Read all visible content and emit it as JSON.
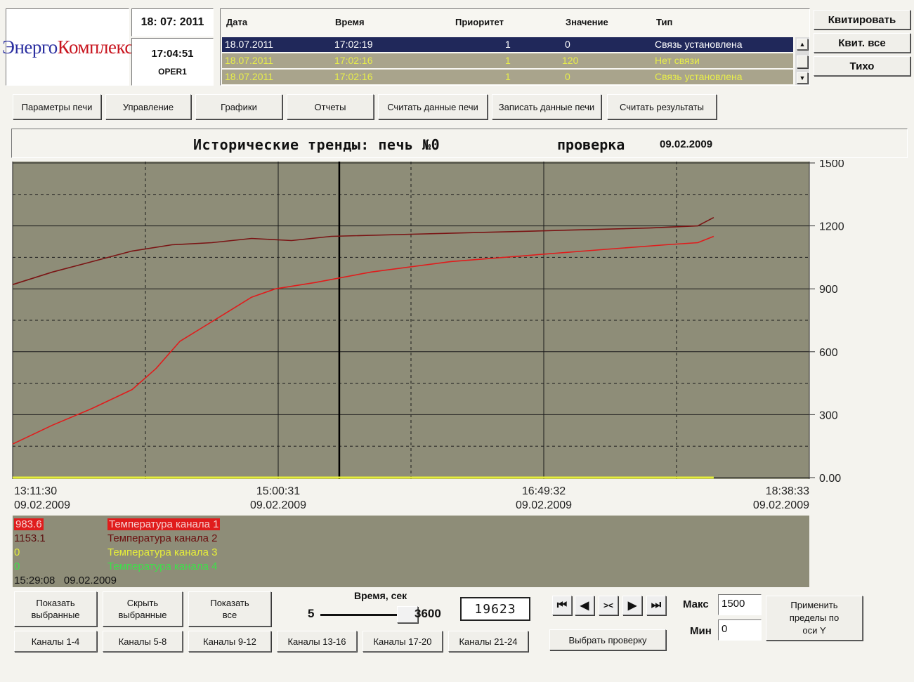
{
  "header": {
    "logo_part1": "Энерго",
    "logo_part2": "Комплекс",
    "date": "18: 07: 2011",
    "time": "17:04:51",
    "user": "OPER1"
  },
  "events": {
    "columns": [
      "Дата",
      "Время",
      "Приоритет",
      "Значение",
      "Тип"
    ],
    "rows": [
      [
        "18.07.2011",
        "17:02:19",
        "1",
        "0",
        "Связь установлена"
      ],
      [
        "18.07.2011",
        "17:02:16",
        "1",
        "120",
        "Нет связи"
      ],
      [
        "18.07.2011",
        "17:02:16",
        "1",
        "0",
        "Связь установлена"
      ]
    ]
  },
  "ack_buttons": [
    "Квитировать",
    "Квит. все",
    "Тихо"
  ],
  "nav_buttons": [
    "Параметры печи",
    "Управление",
    "Графики",
    "Отчеты",
    "Считать данные печи",
    "Записать данные печи",
    "Считать результаты"
  ],
  "title": {
    "main": "Исторические тренды: печь №0",
    "check_label": "проверка",
    "check_date": "09.02.2009"
  },
  "chart_data": {
    "type": "line",
    "ylim": [
      0,
      1500
    ],
    "y_ticks": [
      "1500",
      "1200",
      "900",
      "600",
      "300",
      "0.00"
    ],
    "x_ticks": [
      {
        "time": "13:11:30",
        "date": "09.02.2009"
      },
      {
        "time": "15:00:31",
        "date": "09.02.2009"
      },
      {
        "time": "16:49:32",
        "date": "09.02.2009"
      },
      {
        "time": "18:38:33",
        "date": "09.02.2009"
      }
    ],
    "x_seconds_span": 19623,
    "cursor_fraction": 0.41,
    "series": [
      {
        "name": "Температура канала 1",
        "color": "#e01c1c",
        "x": [
          0,
          0.05,
          0.1,
          0.15,
          0.18,
          0.21,
          0.24,
          0.27,
          0.3,
          0.33,
          0.38,
          0.45,
          0.55,
          0.65,
          0.75,
          0.82,
          0.86,
          0.88
        ],
        "values": [
          160,
          250,
          330,
          420,
          520,
          650,
          720,
          790,
          860,
          900,
          930,
          980,
          1030,
          1060,
          1090,
          1110,
          1120,
          1150
        ]
      },
      {
        "name": "Температура канала 2",
        "color": "#7a1414",
        "x": [
          0,
          0.05,
          0.1,
          0.15,
          0.2,
          0.25,
          0.3,
          0.35,
          0.4,
          0.5,
          0.6,
          0.7,
          0.8,
          0.86,
          0.88
        ],
        "values": [
          920,
          980,
          1030,
          1080,
          1110,
          1120,
          1140,
          1130,
          1150,
          1160,
          1170,
          1180,
          1190,
          1200,
          1240
        ]
      },
      {
        "name": "Температура канала 3",
        "color": "#e6ee3a",
        "x": [
          0,
          0.88
        ],
        "values": [
          0,
          0
        ]
      },
      {
        "name": "Температура канала 4",
        "color": "#3ee04a",
        "x": [
          0,
          0.88
        ],
        "values": [
          0,
          0
        ]
      }
    ]
  },
  "legend": {
    "values": [
      "983.6",
      "1153.1",
      "0",
      "0"
    ],
    "names": [
      "Температура канала 1",
      "Температура канала 2",
      "Температура канала 3",
      "Температура канала 4"
    ],
    "colors": [
      "#e01c1c",
      "#6b1010",
      "#e6ee3a",
      "#3ee04a"
    ],
    "cursor_time": "15:29:08   09.02.2009"
  },
  "bottom": {
    "show_selected": "Показать выбранные",
    "hide_selected": "Скрыть выбранные",
    "show_all": "Показать все",
    "channels": [
      "Каналы 1-4",
      "Каналы 5-8",
      "Каналы 9-12",
      "Каналы 13-16",
      "Каналы 17-20",
      "Каналы 21-24"
    ],
    "time_label": "Время, сек",
    "slider_min": "5",
    "slider_max": "3600",
    "slider_fraction": 0.95,
    "counter": "19623",
    "select_check": "Выбрать проверку",
    "max_label": "Макс",
    "max_value": "1500",
    "min_label": "Мин",
    "min_value": "0",
    "apply_limits": "Применить пределы по оси Y"
  }
}
